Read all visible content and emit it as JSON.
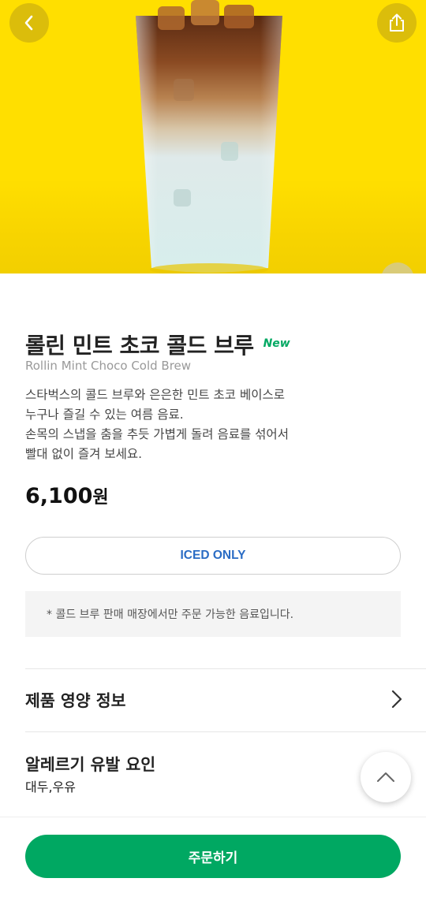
{
  "product": {
    "name_ko": "롤린 민트 초코 콜드 브루",
    "badge": "New",
    "name_en": "Rollin Mint Choco Cold Brew",
    "description_lines": [
      "스타벅스의 콜드 브루와 은은한 민트 초코 베이스로",
      "누구나 즐길 수 있는 여름 음료.",
      "손목의 스냅을 춤을 추듯 가볍게 돌려 음료를 섞어서",
      "빨대 없이 즐겨 보세요."
    ],
    "price_number": "6,100",
    "price_unit": "원",
    "temperature_label": "ICED ONLY",
    "notice": "* 콜드 브루 판매 매장에서만 주문 가능한 음료입니다."
  },
  "sections": {
    "nutrition_title": "제품 영양 정보",
    "allergen_title": "알레르기 유발 요인",
    "allergen_values": "대두,우유"
  },
  "footer": {
    "order_label": "주문하기"
  },
  "icons": {
    "back": "back-arrow-icon",
    "share": "share-icon",
    "chevron": "chevron-right-icon",
    "scroll_top": "chevron-up-icon"
  },
  "colors": {
    "hero_background": "#ffdf00",
    "brand_green": "#00a862",
    "iced_label": "#2a6cc4"
  }
}
